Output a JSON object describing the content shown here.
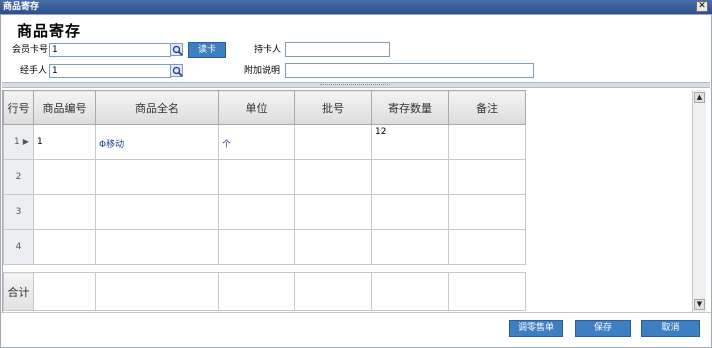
{
  "window": {
    "title": "商品寄存",
    "close_glyph": "✕"
  },
  "form": {
    "heading": "商品寄存",
    "member_card": {
      "label": "会员卡号",
      "value": "1"
    },
    "read_card_label": "读卡",
    "cardholder": {
      "label": "持卡人",
      "value": ""
    },
    "handler": {
      "label": "经手人",
      "value": "1"
    },
    "remark": {
      "label": "附加说明",
      "value": ""
    }
  },
  "grid": {
    "columns": [
      "行号",
      "商品编号",
      "商品全名",
      "单位",
      "批号",
      "寄存数量",
      "备注"
    ],
    "rows": [
      {
        "num": "1",
        "code": "1",
        "name": "Φ移动",
        "unit": "个",
        "batch": "",
        "qty": "12",
        "note": ""
      },
      {
        "num": "2",
        "code": "",
        "name": "",
        "unit": "",
        "batch": "",
        "qty": "",
        "note": ""
      },
      {
        "num": "3",
        "code": "",
        "name": "",
        "unit": "",
        "batch": "",
        "qty": "",
        "note": ""
      },
      {
        "num": "4",
        "code": "",
        "name": "",
        "unit": "",
        "batch": "",
        "qty": "",
        "note": ""
      }
    ],
    "total_label": "合计",
    "current_row_marker": "▶"
  },
  "scrollbar": {
    "up_glyph": "▲",
    "down_glyph": "▼"
  },
  "actions": {
    "adjust": "调零售单",
    "save": "保存",
    "cancel": "取消"
  },
  "icons": {
    "lookup": "magnifier-icon",
    "close": "close-icon",
    "row_pointer": "row-pointer-icon"
  },
  "colors": {
    "title_bar": "#2c4f8e",
    "button": "#3d7fc1",
    "header_bg": "#dcdcdc"
  }
}
